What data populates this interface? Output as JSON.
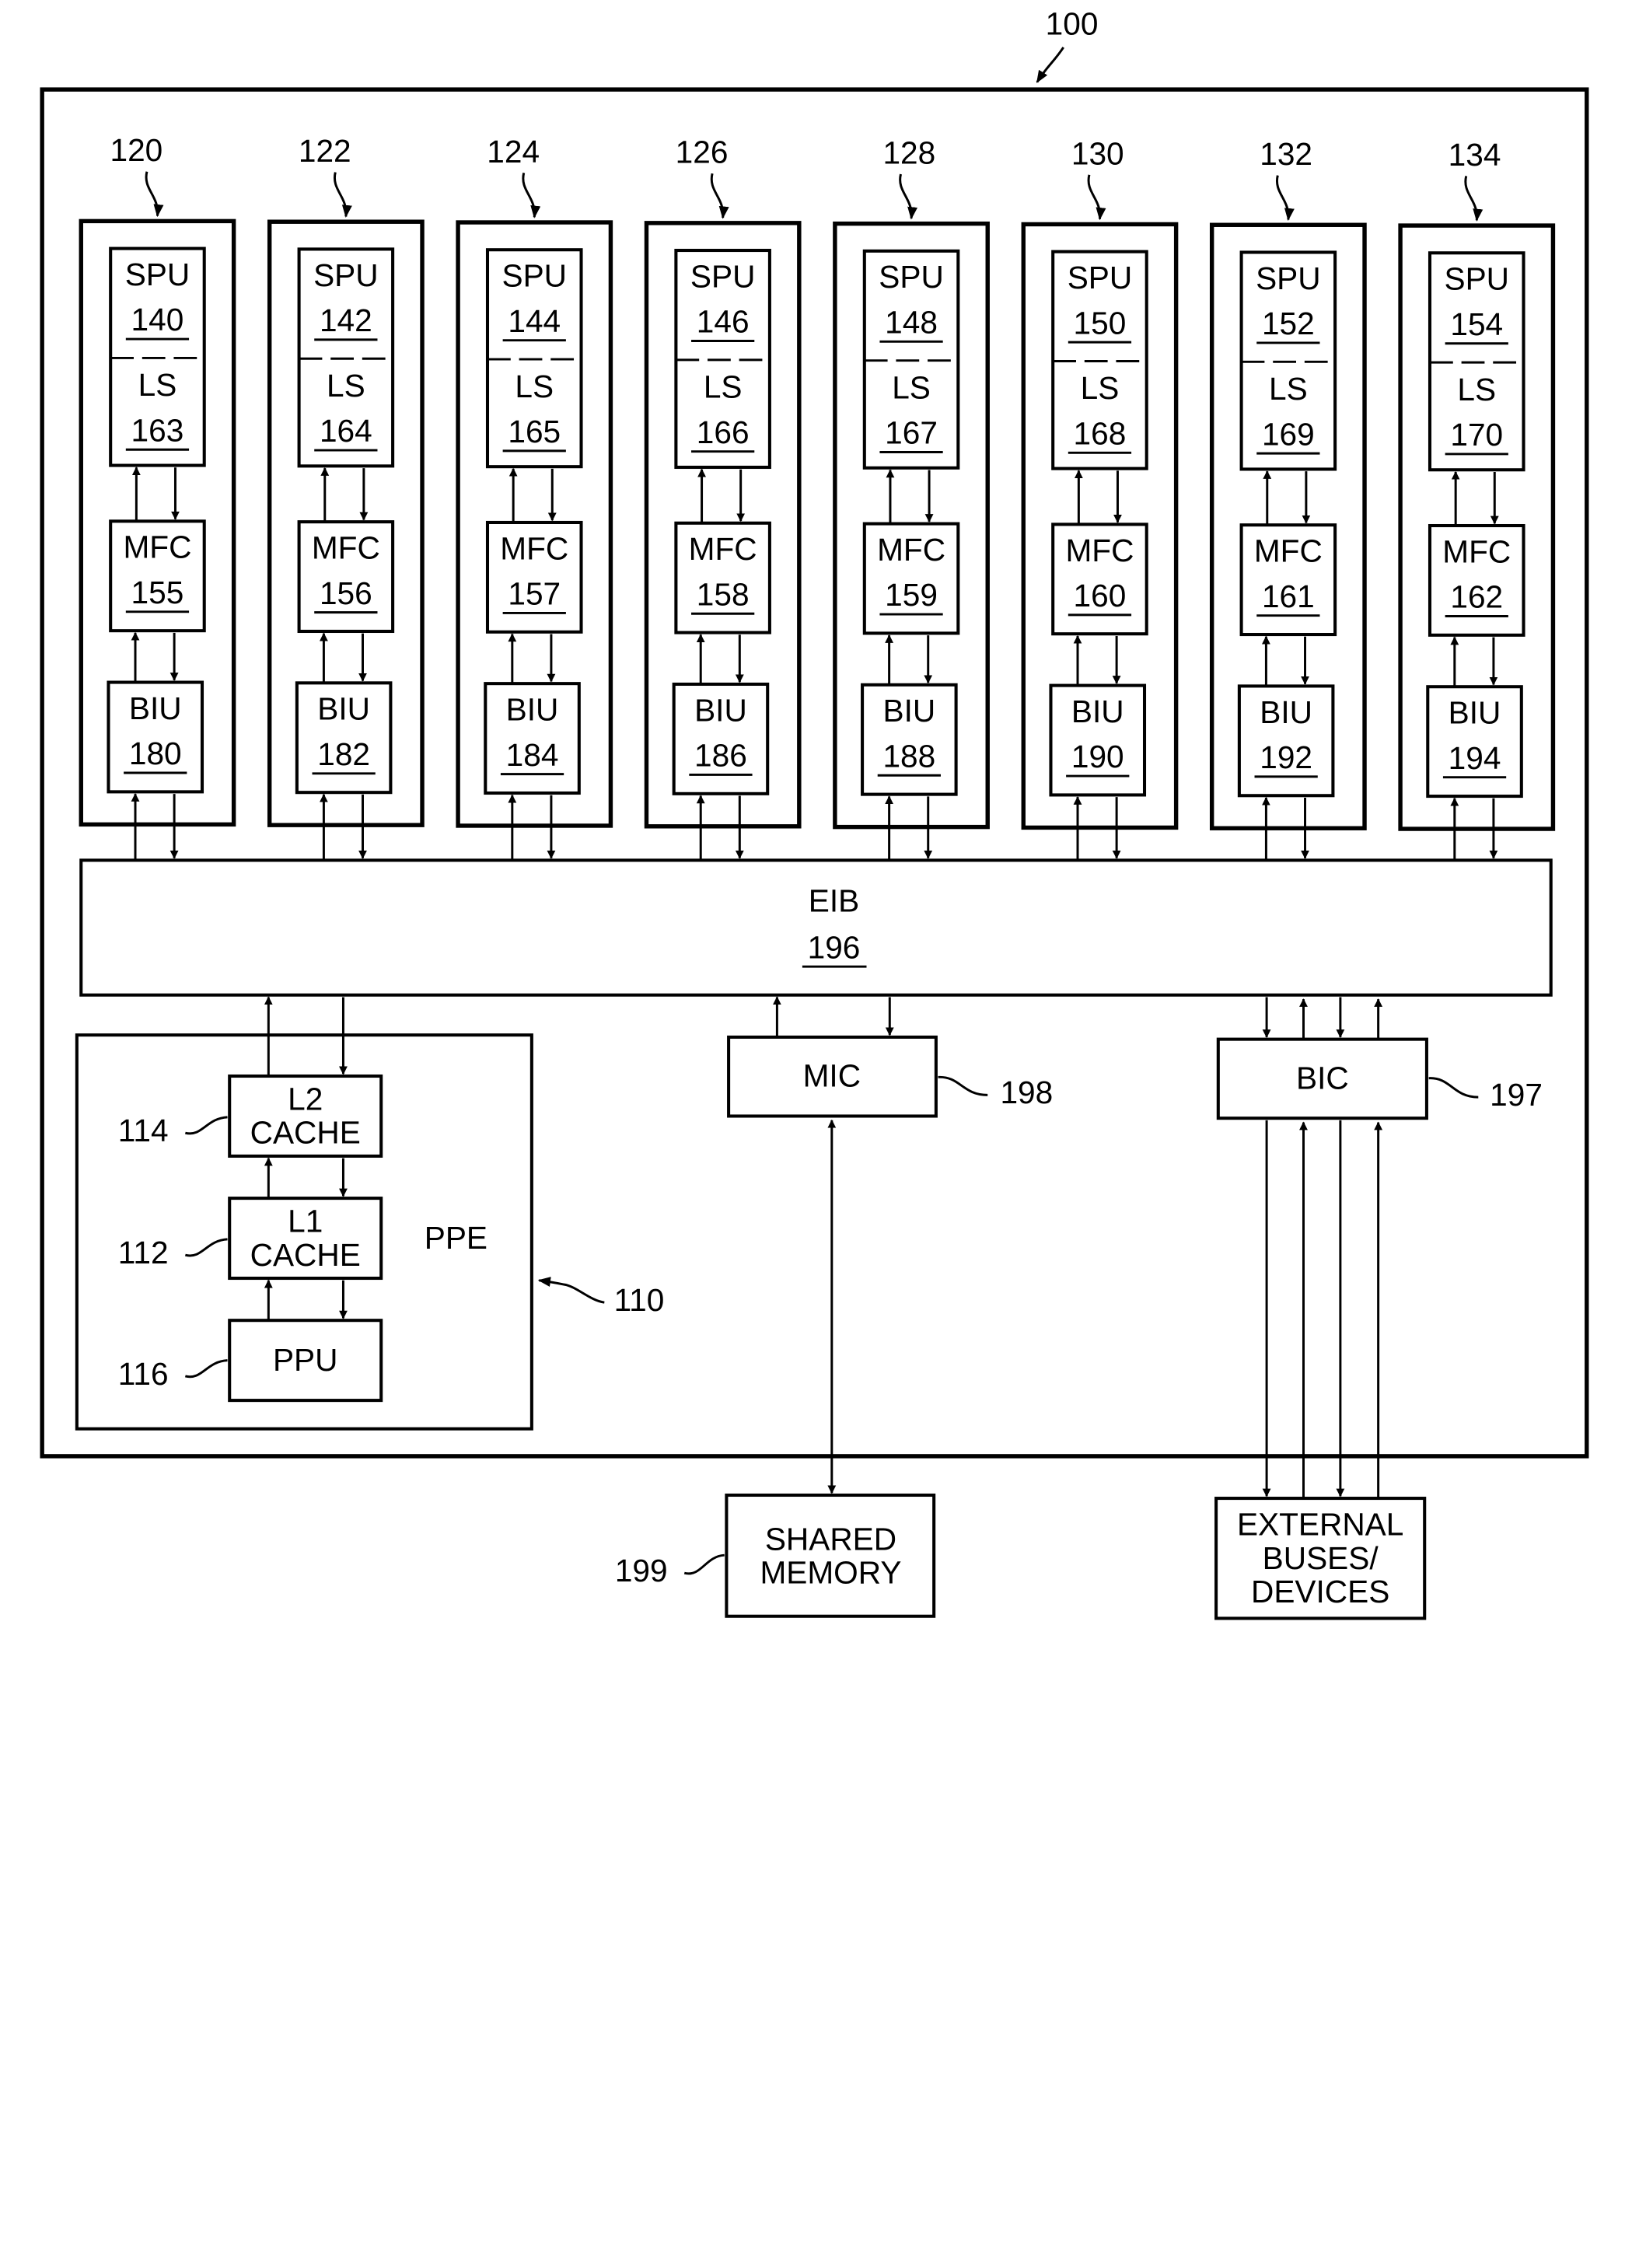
{
  "figure": {
    "system_ref": "100",
    "spe_units": [
      {
        "ref": "120",
        "spu": "SPU",
        "spu_num": "140",
        "ls": "LS",
        "ls_num": "163",
        "mfc": "MFC",
        "mfc_num": "155",
        "biu": "BIU",
        "biu_num": "180"
      },
      {
        "ref": "122",
        "spu": "SPU",
        "spu_num": "142",
        "ls": "LS",
        "ls_num": "164",
        "mfc": "MFC",
        "mfc_num": "156",
        "biu": "BIU",
        "biu_num": "182"
      },
      {
        "ref": "124",
        "spu": "SPU",
        "spu_num": "144",
        "ls": "LS",
        "ls_num": "165",
        "mfc": "MFC",
        "mfc_num": "157",
        "biu": "BIU",
        "biu_num": "184"
      },
      {
        "ref": "126",
        "spu": "SPU",
        "spu_num": "146",
        "ls": "LS",
        "ls_num": "166",
        "mfc": "MFC",
        "mfc_num": "158",
        "biu": "BIU",
        "biu_num": "186"
      },
      {
        "ref": "128",
        "spu": "SPU",
        "spu_num": "148",
        "ls": "LS",
        "ls_num": "167",
        "mfc": "MFC",
        "mfc_num": "159",
        "biu": "BIU",
        "biu_num": "188"
      },
      {
        "ref": "130",
        "spu": "SPU",
        "spu_num": "150",
        "ls": "LS",
        "ls_num": "168",
        "mfc": "MFC",
        "mfc_num": "160",
        "biu": "BIU",
        "biu_num": "190"
      },
      {
        "ref": "132",
        "spu": "SPU",
        "spu_num": "152",
        "ls": "LS",
        "ls_num": "169",
        "mfc": "MFC",
        "mfc_num": "161",
        "biu": "BIU",
        "biu_num": "192"
      },
      {
        "ref": "134",
        "spu": "SPU",
        "spu_num": "154",
        "ls": "LS",
        "ls_num": "170",
        "mfc": "MFC",
        "mfc_num": "162",
        "biu": "BIU",
        "biu_num": "194"
      }
    ],
    "eib": {
      "label": "EIB",
      "num": "196"
    },
    "ppe": {
      "label": "PPE",
      "ref": "110",
      "l2": {
        "line1": "L2",
        "line2": "CACHE",
        "ref": "114"
      },
      "l1": {
        "line1": "L1",
        "line2": "CACHE",
        "ref": "112"
      },
      "ppu": {
        "label": "PPU",
        "ref": "116"
      }
    },
    "mic": {
      "label": "MIC",
      "ref": "198"
    },
    "bic": {
      "label": "BIC",
      "ref": "197"
    },
    "shared_memory": {
      "line1": "SHARED",
      "line2": "MEMORY",
      "ref": "199"
    },
    "external": {
      "line1": "EXTERNAL",
      "line2": "BUSES/",
      "line3": "DEVICES"
    }
  }
}
